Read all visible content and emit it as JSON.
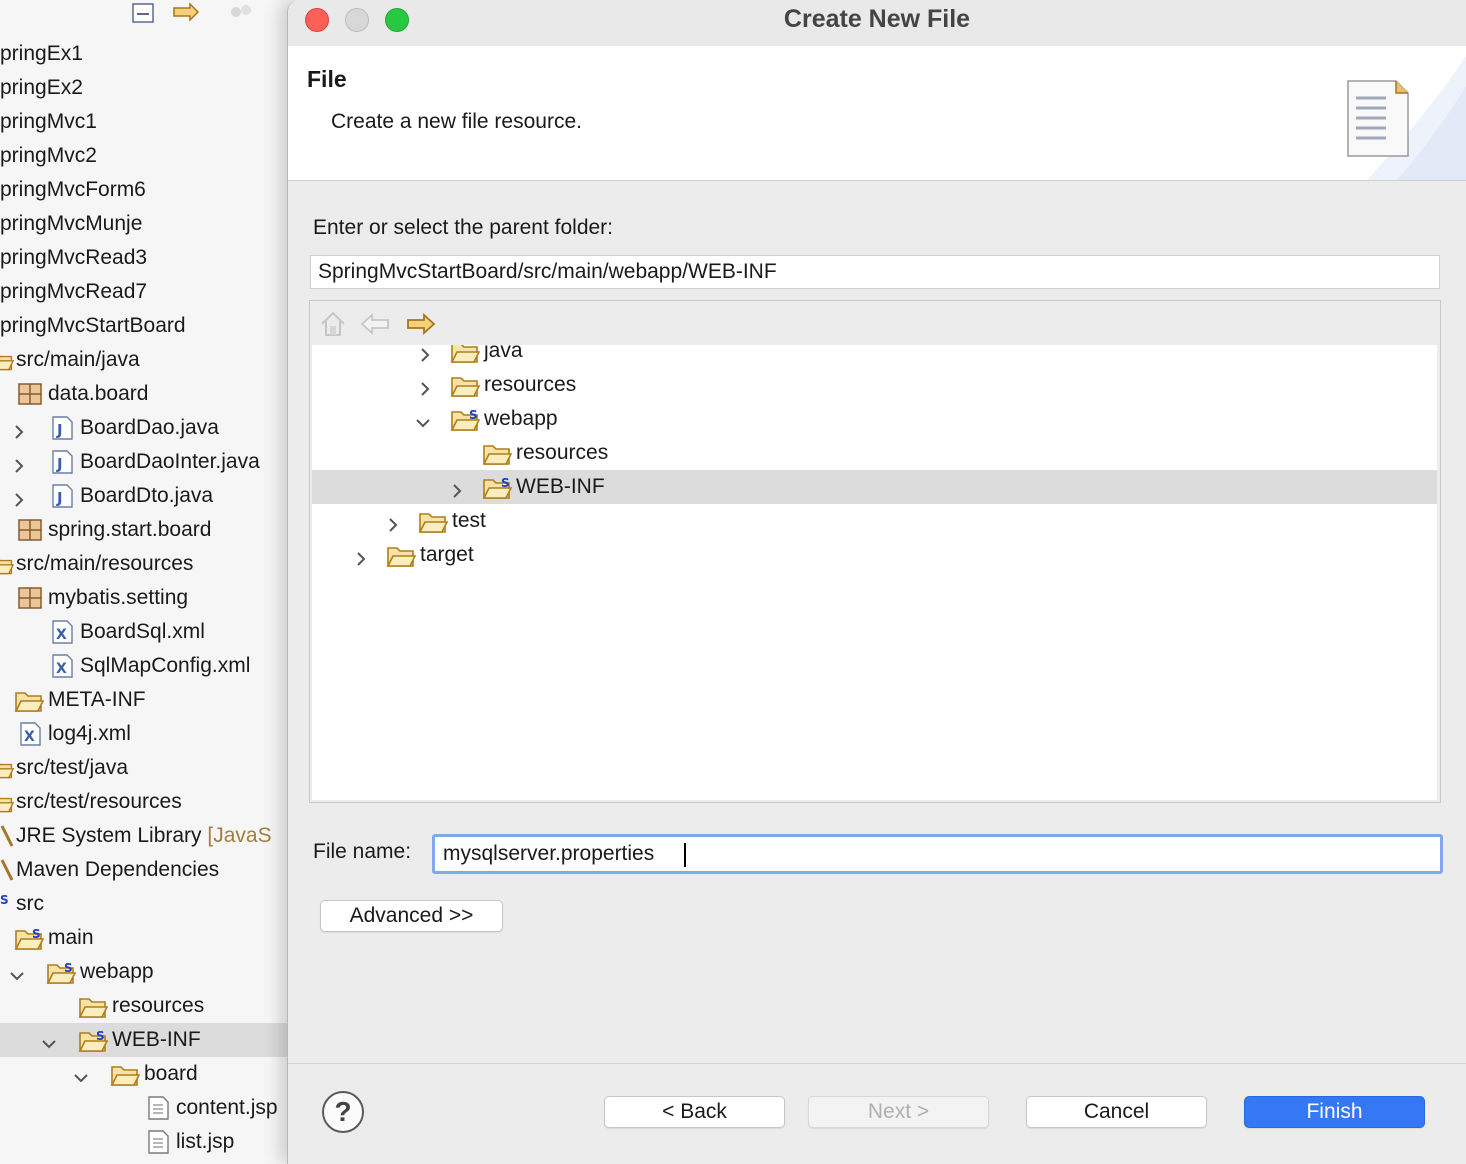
{
  "explorer": {
    "items": [
      {
        "label": "pringEx1"
      },
      {
        "label": "pringEx2"
      },
      {
        "label": "pringMvc1"
      },
      {
        "label": "pringMvc2"
      },
      {
        "label": "pringMvcForm6"
      },
      {
        "label": "pringMvcMunje"
      },
      {
        "label": "pringMvcRead3"
      },
      {
        "label": "pringMvcRead7"
      },
      {
        "label": "pringMvcStartBoard"
      },
      {
        "label": "src/main/java"
      },
      {
        "label": "data.board"
      },
      {
        "label": "BoardDao.java"
      },
      {
        "label": "BoardDaoInter.java"
      },
      {
        "label": "BoardDto.java"
      },
      {
        "label": "spring.start.board"
      },
      {
        "label": "src/main/resources"
      },
      {
        "label": "mybatis.setting"
      },
      {
        "label": "BoardSql.xml"
      },
      {
        "label": "SqlMapConfig.xml"
      },
      {
        "label": "META-INF"
      },
      {
        "label": "log4j.xml"
      },
      {
        "label": "src/test/java"
      },
      {
        "label": "src/test/resources"
      },
      {
        "label": "JRE System Library",
        "extra": "[JavaS"
      },
      {
        "label": "Maven Dependencies"
      },
      {
        "label": "src"
      },
      {
        "label": "main"
      },
      {
        "label": "webapp"
      },
      {
        "label": "resources"
      },
      {
        "label": "WEB-INF"
      },
      {
        "label": "board"
      },
      {
        "label": "content.jsp"
      },
      {
        "label": "list.jsp"
      }
    ]
  },
  "dialog": {
    "title": "Create New File",
    "banner_title": "File",
    "banner_description": "Create a new file resource.",
    "parent_folder_label": "Enter or select the parent folder:",
    "parent_folder_value": "SpringMvcStartBoard/src/main/webapp/WEB-INF",
    "folder_tree": [
      {
        "label": "java"
      },
      {
        "label": "resources"
      },
      {
        "label": "webapp"
      },
      {
        "label": "resources"
      },
      {
        "label": "WEB-INF"
      },
      {
        "label": "test"
      },
      {
        "label": "target"
      }
    ],
    "file_name_label": "File name:",
    "file_name_value": "mysqlserver.properties",
    "advanced_label": "Advanced >>",
    "help_label": "?",
    "back_label": "< Back",
    "next_label": "Next >",
    "cancel_label": "Cancel",
    "finish_label": "Finish"
  },
  "colors": {
    "accent": "#3478f6",
    "folder": "#e8b84a",
    "close": "#fe5f57",
    "minimize": "#d8d8d8",
    "zoom": "#28c840"
  }
}
